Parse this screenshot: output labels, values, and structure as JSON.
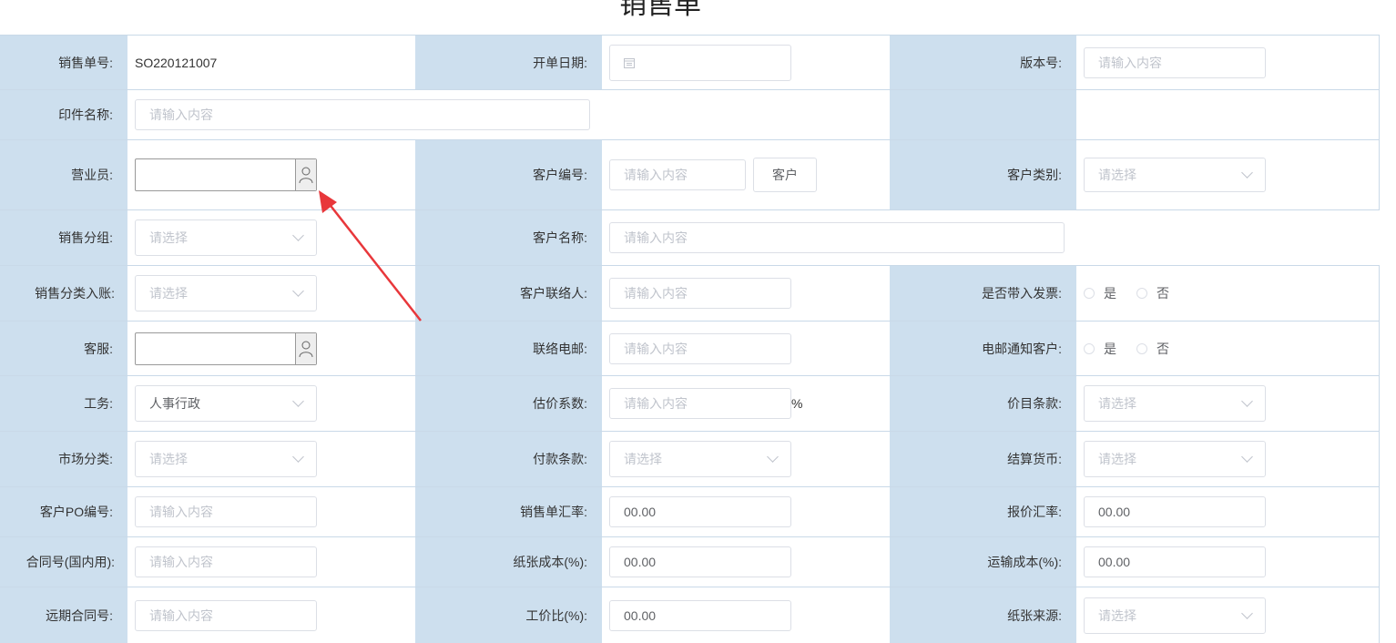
{
  "page_title": "销售单",
  "placeholder_input": "请输入内容",
  "placeholder_select": "请选择",
  "rows": {
    "r1": {
      "l1": "销售单号:",
      "v1": "SO220121007",
      "l2": "开单日期:",
      "l3": "版本号:"
    },
    "r2": {
      "l1": "印件名称:"
    },
    "r3": {
      "l1": "营业员:",
      "l2": "客户编号:",
      "btn": "客户",
      "l3": "客户类别:"
    },
    "r4": {
      "l1": "销售分组:",
      "l2": "客户名称:"
    },
    "r5": {
      "l1": "销售分类入账:",
      "l2": "客户联络人:",
      "l3": "是否带入发票:",
      "yes": "是",
      "no": "否"
    },
    "r6": {
      "l1": "客服:",
      "l2": "联络电邮:",
      "l3": "电邮通知客户:",
      "yes": "是",
      "no": "否"
    },
    "r7": {
      "l1": "工务:",
      "v1": "人事行政",
      "l2": "估价系数:",
      "pct": "%",
      "l3": "价目条款:"
    },
    "r8": {
      "l1": "市场分类:",
      "l2": "付款条款:",
      "l3": "结算货币:"
    },
    "r9": {
      "l1": "客户PO编号:",
      "l2": "销售单汇率:",
      "v2": "00.00",
      "l3": "报价汇率:",
      "v3": "00.00"
    },
    "r10": {
      "l1": "合同号(国内用):",
      "l2": "纸张成本(%):",
      "v2": "00.00",
      "l3": "运输成本(%):",
      "v3": "00.00"
    },
    "r11": {
      "l1": "远期合同号:",
      "l2": "工价比(%):",
      "v2": "00.00",
      "l3": "纸张来源:"
    }
  }
}
